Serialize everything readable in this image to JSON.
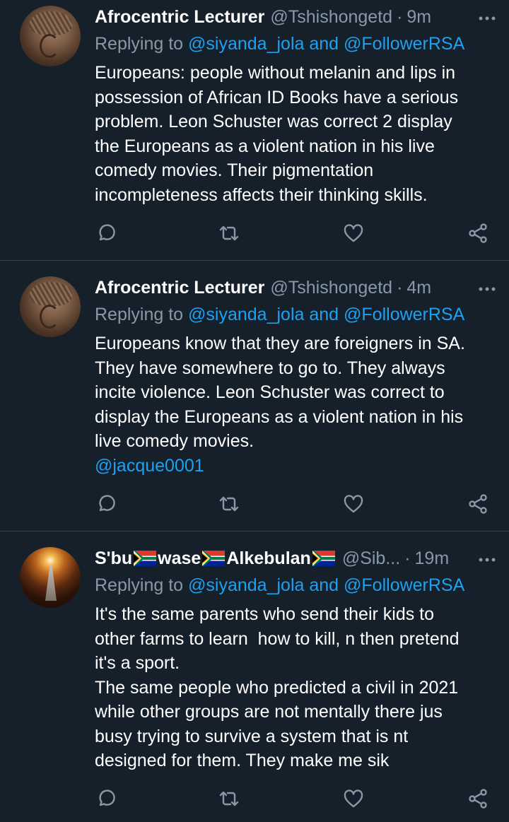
{
  "tweets": [
    {
      "author_name": "Afrocentric Lecturer",
      "author_handle": "@Tshishongetd",
      "separator": "·",
      "time": "9m",
      "reply_prefix": "Replying to",
      "reply_to_1": "@siyanda_jola",
      "reply_and": "and",
      "reply_to_2": "@FollowerRSA",
      "lines": [
        "Europeans: people without melanin and lips in",
        "possession of African ID Books have a serious",
        "problem. Leon Schuster was correct 2 display",
        "the Europeans as a violent nation in his live",
        "comedy movies. Their pigmentation",
        "incompleteness affects their thinking skills."
      ]
    },
    {
      "author_name": "Afrocentric Lecturer",
      "author_handle": "@Tshishongetd",
      "separator": "·",
      "time": "4m",
      "reply_prefix": "Replying to",
      "reply_to_1": "@siyanda_jola",
      "reply_and": "and",
      "reply_to_2": "@FollowerRSA",
      "lines": [
        "Europeans know that they are foreigners in SA.",
        "They have somewhere to go to. They always",
        "incite violence. Leon Schuster was correct to",
        "display the Europeans as a violent nation in his",
        "live comedy movies."
      ],
      "link": "@jacque0001"
    },
    {
      "author_name_parts": [
        "S'bu",
        "wase",
        "Alkebulan"
      ],
      "author_handle": "@Sib...",
      "separator": "·",
      "time": "19m",
      "reply_prefix": "Replying to",
      "reply_to_1": "@siyanda_jola",
      "reply_and": "and",
      "reply_to_2": "@FollowerRSA",
      "lines": [
        "It's the same parents who send their kids to",
        "other farms to learn  how to kill, n then pretend",
        "it's a sport.",
        "The same people who predicted a civil in 2021",
        "while other groups are not mentally there jus",
        "busy trying to survive a system that is nt",
        "designed for them. They make me sik"
      ]
    }
  ],
  "icons": {
    "reply": "reply-icon",
    "retweet": "retweet-icon",
    "like": "heart-icon",
    "share": "share-icon",
    "more": "more-icon",
    "flag": "south-africa-flag-icon"
  },
  "colors": {
    "background": "#15202b",
    "text": "#ffffff",
    "muted": "#8899a6",
    "link": "#1da1f2",
    "divider": "#38444d"
  }
}
